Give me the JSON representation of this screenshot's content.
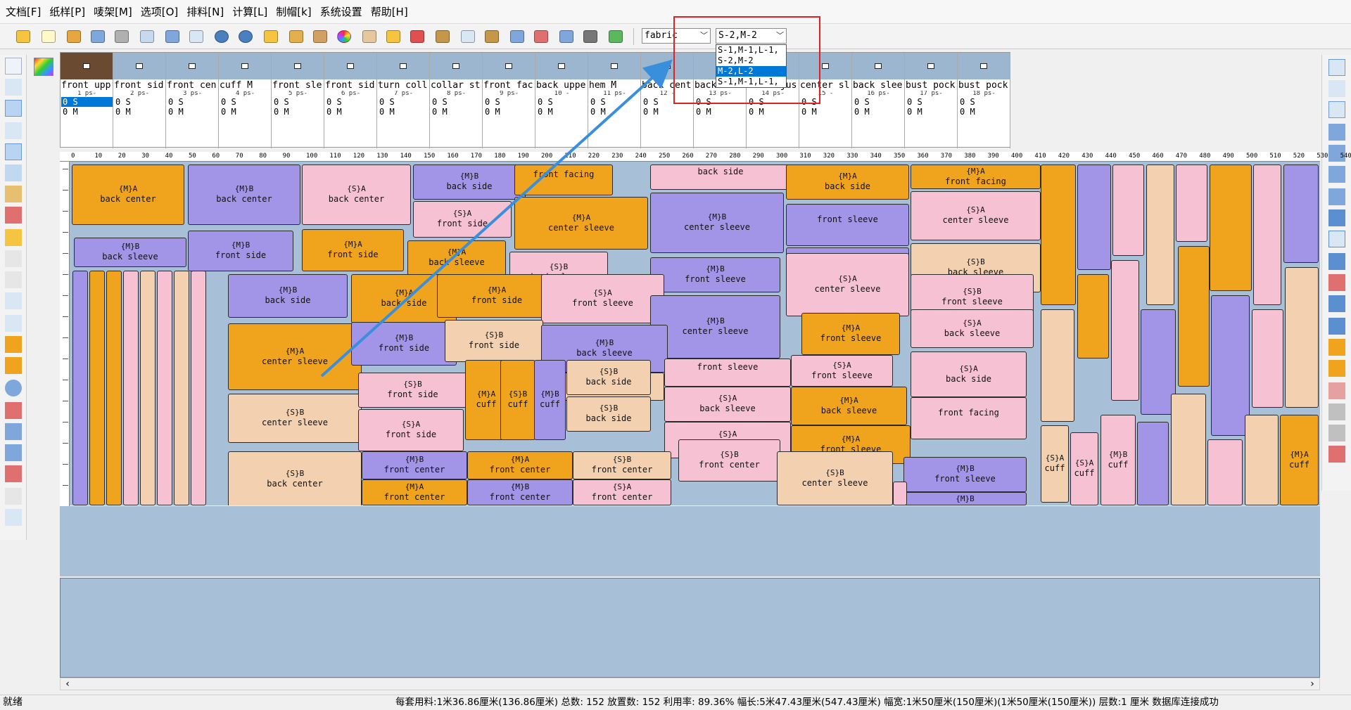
{
  "menu": [
    "文档[F]",
    "纸样[P]",
    "唛架[M]",
    "选项[O]",
    "排料[N]",
    "计算[L]",
    "制帽[k]",
    "系统设置",
    "帮助[H]"
  ],
  "toolbar": {
    "fabric_combo": "fabric",
    "size_combo": "S-2,M-2",
    "size_options": [
      "S-1,M-1,L-1,",
      "S-2,M-2",
      "M-2,L-2",
      "S-1,M-1,L-1,"
    ],
    "selected_option_index": 2
  },
  "pieces": [
    {
      "name": "front upp",
      "num": "1  ps-"
    },
    {
      "name": "front sid",
      "num": "2  ps-"
    },
    {
      "name": "front cen",
      "num": "3  ps-"
    },
    {
      "name": "cuff    M",
      "num": "4  ps-"
    },
    {
      "name": "front sle",
      "num": "5  ps-"
    },
    {
      "name": "front sid",
      "num": "6  ps-"
    },
    {
      "name": "turn coll",
      "num": "7  ps-"
    },
    {
      "name": "collar st",
      "num": "8  ps-"
    },
    {
      "name": "front fac",
      "num": "9  ps-"
    },
    {
      "name": "back uppe",
      "num": "10  -"
    },
    {
      "name": "hem     M",
      "num": "11  ps-"
    },
    {
      "name": "back cent",
      "num": "12  -"
    },
    {
      "name": "back side",
      "num": "13  ps-"
    },
    {
      "name": "hem adjus",
      "num": "14  ps-"
    },
    {
      "name": "center sl",
      "num": "15  -"
    },
    {
      "name": "back slee",
      "num": "16  ps-"
    },
    {
      "name": "bust pock",
      "num": "17  ps-"
    },
    {
      "name": "bust pock",
      "num": "18  ps-"
    }
  ],
  "piece_count_row1": "0  S",
  "piece_count_row2": "0  M",
  "marker_labels": {
    "back_center": "back center",
    "back_side": "back side",
    "back_sleeve": "back sleeve",
    "front_side": "front side",
    "center_sleeve": "center sleeve",
    "front_sleeve": "front sleeve",
    "front_center": "front center",
    "front_facing": "front facing",
    "cuff": "cuff",
    "size_MB": "{M}B",
    "size_MA": "{M}A",
    "size_SA": "{S}A",
    "size_SB": "{S}B"
  },
  "ruler_ticks": [
    "0",
    "10",
    "20",
    "30",
    "40",
    "50",
    "60",
    "70",
    "80",
    "90",
    "100",
    "110",
    "120",
    "130",
    "140",
    "150",
    "160",
    "170",
    "180",
    "190",
    "200",
    "210",
    "220",
    "230",
    "240",
    "250",
    "260",
    "270",
    "280",
    "290",
    "300",
    "310",
    "320",
    "330",
    "340",
    "350",
    "360",
    "370",
    "380",
    "390",
    "400",
    "410",
    "420",
    "430",
    "440",
    "450",
    "460",
    "470",
    "480",
    "490",
    "500",
    "510",
    "520",
    "530",
    "540"
  ],
  "status": {
    "ready": "就绪",
    "info": "每套用料:1米36.86厘米(136.86厘米) 总数: 152 放置数: 152 利用率: 89.36% 幅长:5米47.43厘米(547.43厘米) 幅宽:1米50厘米(150厘米)(1米50厘米(150厘米)) 层数:1 厘米  数据库连接成功"
  },
  "colors": {
    "orange": "#f0a41e",
    "purple": "#a294e6",
    "pink": "#f6c1d2",
    "tan": "#f3d1b0",
    "background": "#a8bfd8",
    "highlight": "#0078d7",
    "annotation_red": "#e62020",
    "annotation_arrow": "#3a8fdc"
  }
}
